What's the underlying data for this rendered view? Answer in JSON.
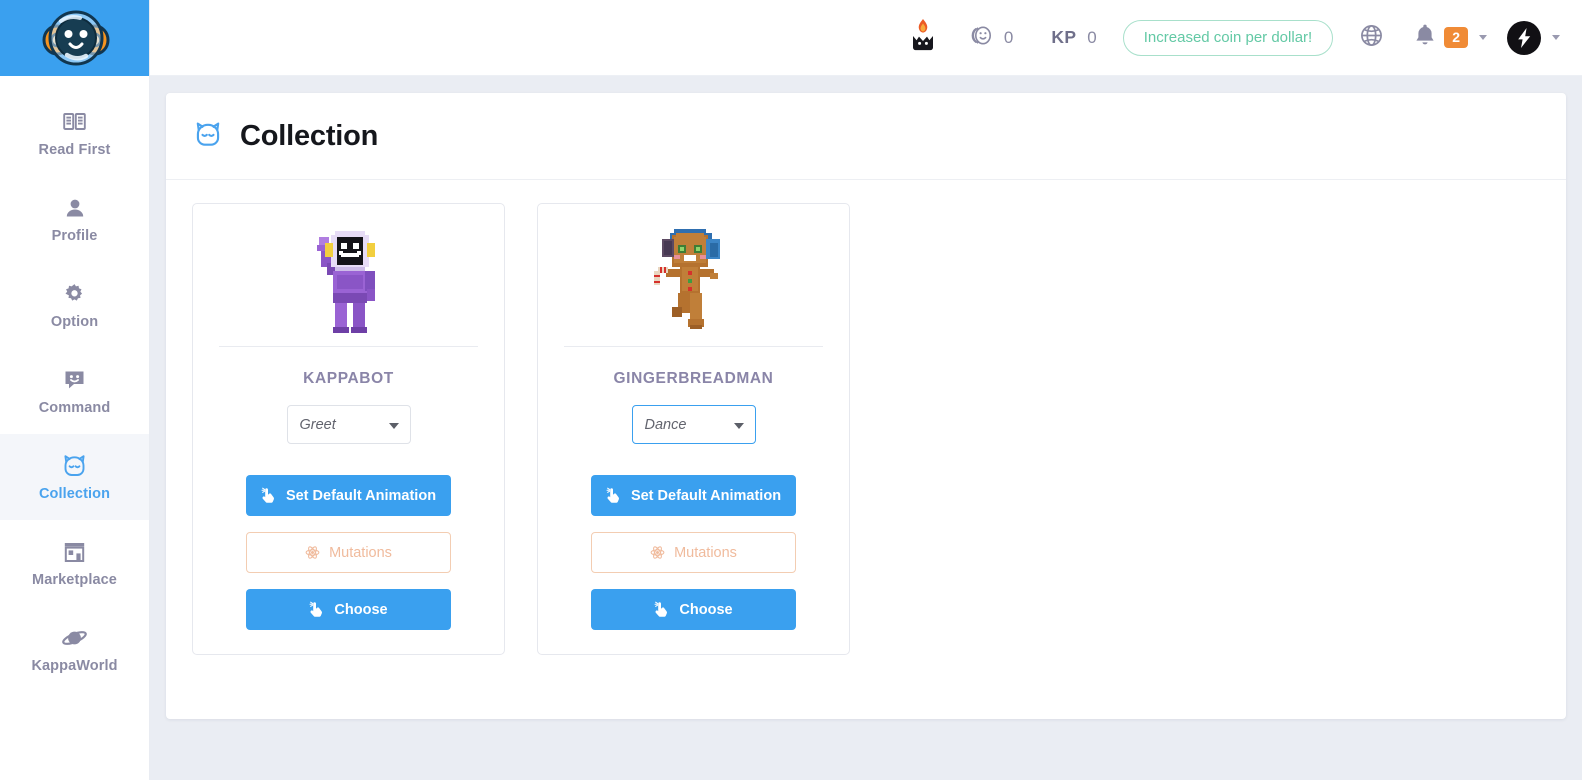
{
  "brand": {
    "logo_icon": "kappa-astronaut-logo",
    "logo_bg": "#3aa0ef"
  },
  "sidebar": {
    "items": [
      {
        "label": "Read First",
        "icon": "book-icon",
        "active": false
      },
      {
        "label": "Profile",
        "icon": "user-icon",
        "active": false
      },
      {
        "label": "Option",
        "icon": "gear-icon",
        "active": false
      },
      {
        "label": "Command",
        "icon": "chat-smiley-icon",
        "active": false
      },
      {
        "label": "Collection",
        "icon": "cat-face-icon",
        "active": true
      },
      {
        "label": "Marketplace",
        "icon": "store-icon",
        "active": false
      },
      {
        "label": "KappaWorld",
        "icon": "planet-icon",
        "active": false
      }
    ]
  },
  "topbar": {
    "flame_icon": "flame-cat-icon",
    "coin_icon": "coin-icon",
    "coin_value": "0",
    "kp_label": "KP",
    "kp_value": "0",
    "promo_text": "Increased coin per dollar!",
    "promo_color": "#63c9a5",
    "globe_icon": "globe-icon",
    "bell_icon": "bell-icon",
    "notification_count": "2",
    "badge_color": "#f08b36",
    "avatar_icon": "lightning-bolt-avatar"
  },
  "page": {
    "icon": "cat-face-icon",
    "title": "Collection"
  },
  "cards": [
    {
      "art": "purple-astronaut-pixel-art",
      "name": "KAPPABOT",
      "animation_value": "Greet",
      "animation_focused": false,
      "set_default_label": "Set Default Animation",
      "mutations_label": "Mutations",
      "choose_label": "Choose"
    },
    {
      "art": "gingerbread-man-pixel-art",
      "name": "GINGERBREADMAN",
      "animation_value": "Dance",
      "animation_focused": true,
      "set_default_label": "Set Default Animation",
      "mutations_label": "Mutations",
      "choose_label": "Choose"
    }
  ],
  "colors": {
    "accent_blue": "#3aa0ef",
    "sidebar_text": "#8a8aa3",
    "card_name": "#8a85a8",
    "mutations_outline": "#f3cdb2",
    "page_bg": "#eaedf3"
  }
}
